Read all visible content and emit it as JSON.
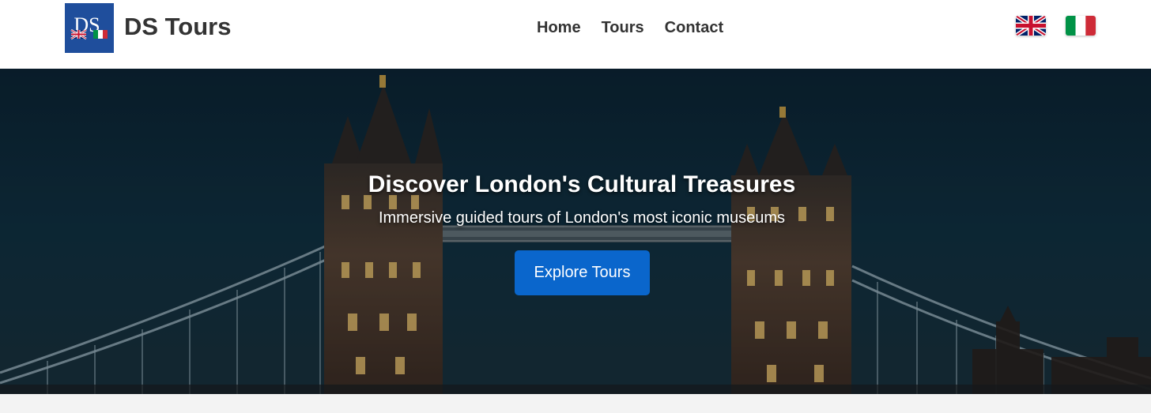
{
  "header": {
    "brand": "DS Tours",
    "logo_monogram": "DS",
    "nav": [
      {
        "label": "Home"
      },
      {
        "label": "Tours"
      },
      {
        "label": "Contact"
      }
    ],
    "languages": [
      {
        "flag": "uk-flag-icon"
      },
      {
        "flag": "italy-flag-icon"
      }
    ]
  },
  "hero": {
    "title": "Discover London's Cultural Treasures",
    "subtitle": "Immersive guided tours of London's most iconic museums",
    "cta_label": "Explore Tours",
    "background": "tower-bridge-night-photo"
  },
  "colors": {
    "logo_bg": "#1f4e9c",
    "cta": "#0a66cc",
    "text_dark": "#333333"
  }
}
